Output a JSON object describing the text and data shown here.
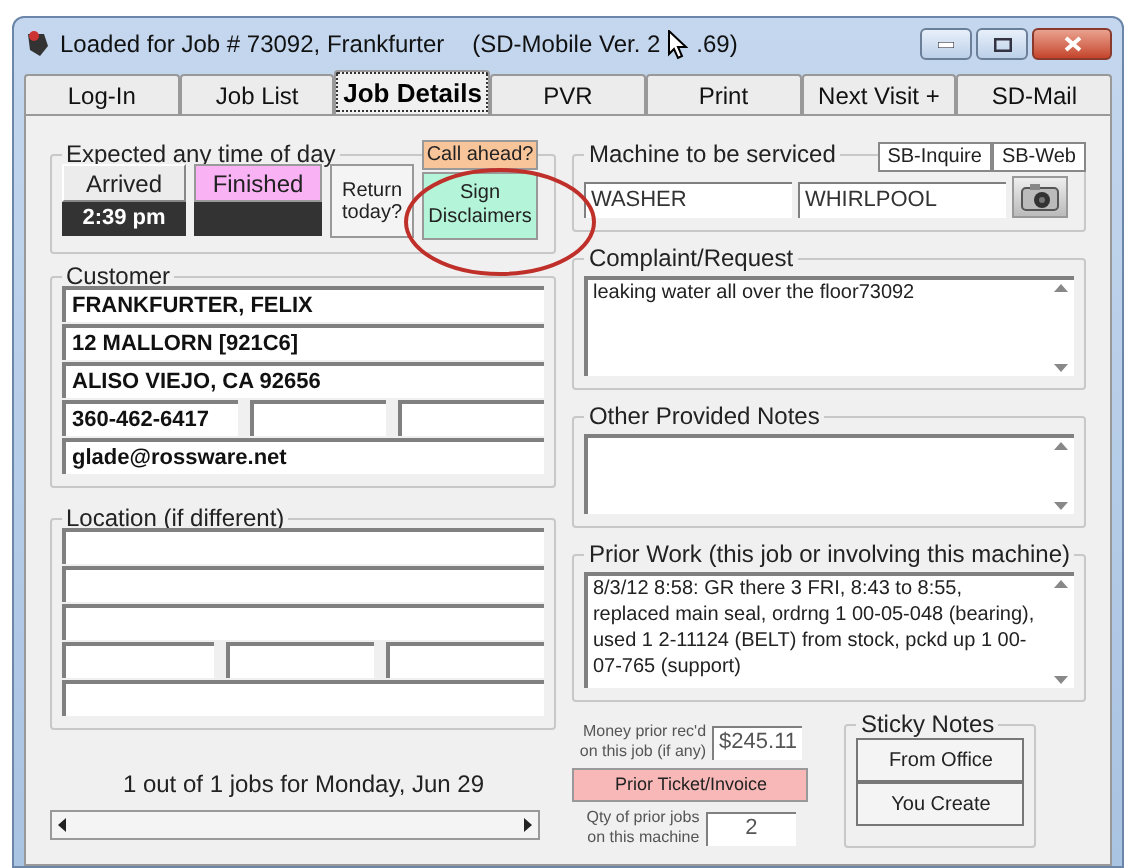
{
  "window": {
    "title": "Loaded for Job # 73092, Frankfurter",
    "version_start": "(SD-Mobile Ver. 2",
    "version_end": ".69)"
  },
  "tabs": [
    {
      "label": "Log-In",
      "selected": false
    },
    {
      "label": "Job List",
      "selected": false
    },
    {
      "label": "Job Details",
      "selected": true
    },
    {
      "label": "PVR",
      "selected": false
    },
    {
      "label": "Print",
      "selected": false
    },
    {
      "label": "Next Visit +",
      "selected": false
    },
    {
      "label": "SD-Mail",
      "selected": false
    }
  ],
  "schedule": {
    "title": "Expected any time of day",
    "arrived": "Arrived",
    "arrived_time": "2:39 pm",
    "finished": "Finished",
    "return_today": "Return today?",
    "call_ahead": "Call ahead?",
    "sign_disclaimers": "Sign Disclaimers"
  },
  "customer": {
    "title": "Customer",
    "name": "FRANKFURTER, FELIX",
    "address": "12 MALLORN [921C6]",
    "city": "ALISO VIEJO, CA 92656",
    "phone": "360-462-6417",
    "email": "glade@rossware.net"
  },
  "location": {
    "title": "Location (if different)"
  },
  "job_count": "1 out of 1 jobs for Monday, Jun 29",
  "machine": {
    "title": "Machine to be serviced",
    "type": "WASHER",
    "brand": "WHIRLPOOL",
    "buttons": [
      "SB-Inquire",
      "SB-Web"
    ]
  },
  "complaint": {
    "title": "Complaint/Request",
    "text": "leaking water all over the floor73092"
  },
  "other_notes": {
    "title": "Other Provided Notes"
  },
  "prior_work": {
    "title": "Prior Work (this job or involving this machine)",
    "text": "8/3/12 8:58: GR there 3 FRI, 8:43 to 8:55, replaced main seal, ordrng 1 00-05-048 (bearing), used 1 2-11124 (BELT) from stock, pckd up 1 00-07-765 (support)"
  },
  "money": {
    "label_lines": [
      "Money prior rec'd",
      "on this job (if any)"
    ],
    "value": "$245.11"
  },
  "prior_ticket": "Prior Ticket/Invoice",
  "qty": {
    "label_lines": [
      "Qty of prior jobs",
      "on this machine"
    ],
    "value": "2"
  },
  "sticky": {
    "title": "Sticky Notes",
    "buttons": [
      "From Office",
      "You Create"
    ]
  }
}
